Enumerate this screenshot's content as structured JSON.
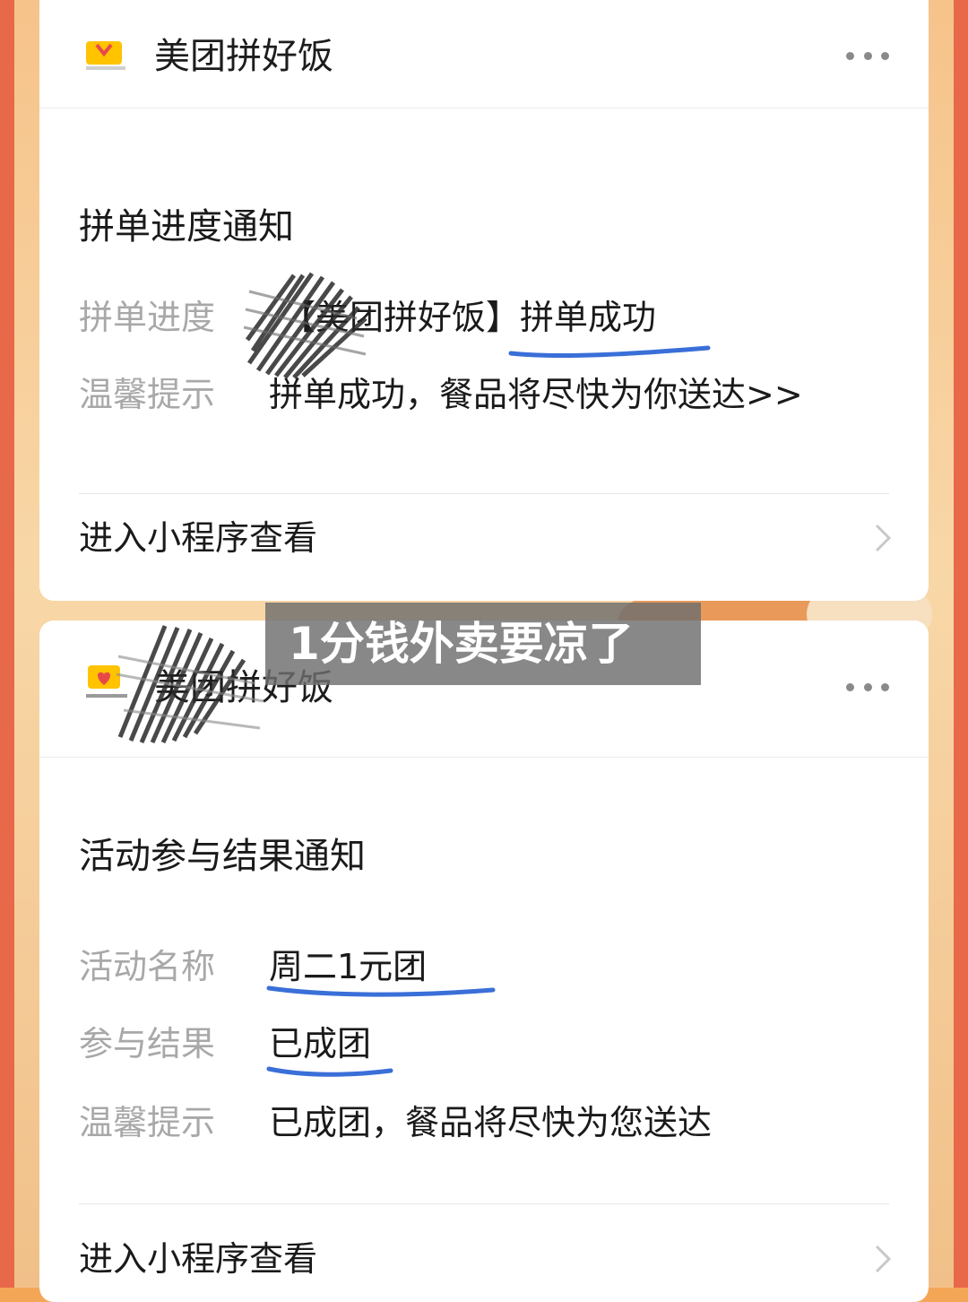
{
  "cards": [
    {
      "header": {
        "app_name": "美团拼好饭",
        "more_icon": "more-dots-icon"
      },
      "notice_title": "拼单进度通知",
      "rows": [
        {
          "label": "拼单进度",
          "value": "【美团拼好饭】拼单成功"
        },
        {
          "label": "温馨提示",
          "value": "拼单成功，餐品将尽快为你送达>>"
        }
      ],
      "link": {
        "label": "进入小程序查看",
        "icon": "chevron-right-icon"
      }
    },
    {
      "header": {
        "app_name": "美团拼好饭",
        "logo_caption": "美团拼好饭",
        "more_icon": "more-dots-icon"
      },
      "notice_title": "活动参与结果通知",
      "rows": [
        {
          "label": "活动名称",
          "value": "周二1元团"
        },
        {
          "label": "参与结果",
          "value": "已成团"
        },
        {
          "label": "温馨提示",
          "value": "已成团，餐品将尽快为您送达"
        }
      ],
      "link": {
        "label": "进入小程序查看",
        "icon": "chevron-right-icon"
      }
    }
  ],
  "overlay": {
    "caption": "1分钱外卖要凉了"
  },
  "colors": {
    "underline": "#3a6fd8",
    "brand_yellow": "#ffc300",
    "brand_red": "#e8484a"
  }
}
